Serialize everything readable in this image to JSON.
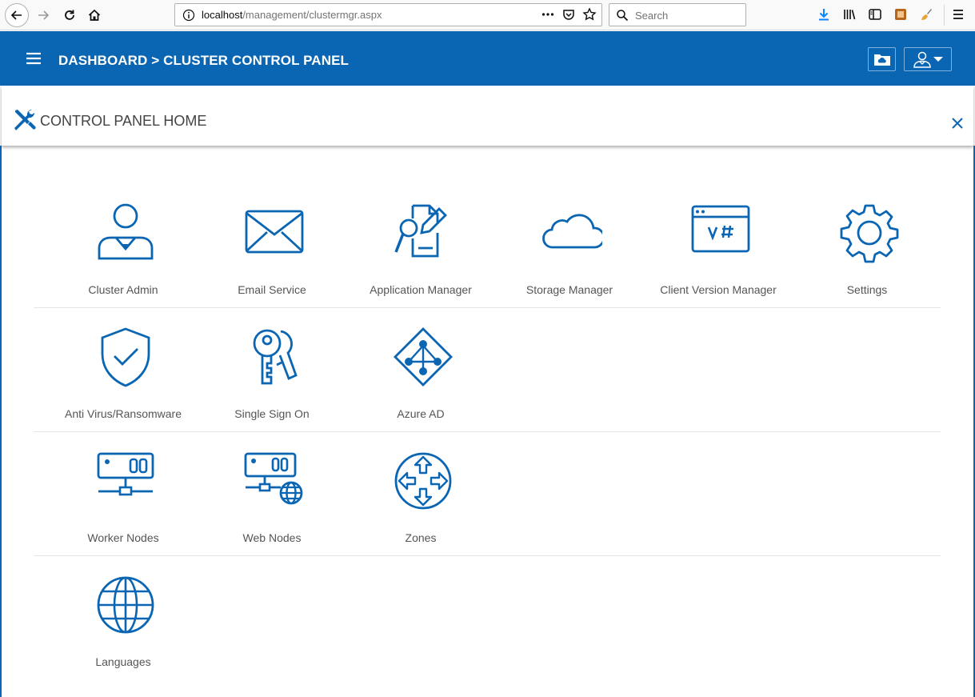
{
  "browser": {
    "url_host": "localhost",
    "url_path": "/management/clustermgr.aspx",
    "search_placeholder": "Search"
  },
  "header": {
    "title": "DASHBOARD > CLUSTER CONTROL PANEL",
    "accent_color": "#0a65b3"
  },
  "panel": {
    "title": "CONTROL PANEL HOME"
  },
  "tiles": [
    [
      {
        "label": "Cluster Admin",
        "icon": "user-admin-icon"
      },
      {
        "label": "Email Service",
        "icon": "envelope-icon"
      },
      {
        "label": "Application Manager",
        "icon": "document-search-icon"
      },
      {
        "label": "Storage Manager",
        "icon": "cloud-icon"
      },
      {
        "label": "Client Version Manager",
        "icon": "window-version-icon"
      },
      {
        "label": "Settings",
        "icon": "gear-icon"
      }
    ],
    [
      {
        "label": "Anti Virus/Ransomware",
        "icon": "shield-check-icon"
      },
      {
        "label": "Single Sign On",
        "icon": "keys-icon"
      },
      {
        "label": "Azure AD",
        "icon": "azure-ad-icon"
      }
    ],
    [
      {
        "label": "Worker Nodes",
        "icon": "server-node-icon"
      },
      {
        "label": "Web Nodes",
        "icon": "web-node-icon"
      },
      {
        "label": "Zones",
        "icon": "zones-arrows-icon"
      }
    ],
    [
      {
        "label": "Languages",
        "icon": "globe-icon"
      }
    ]
  ]
}
